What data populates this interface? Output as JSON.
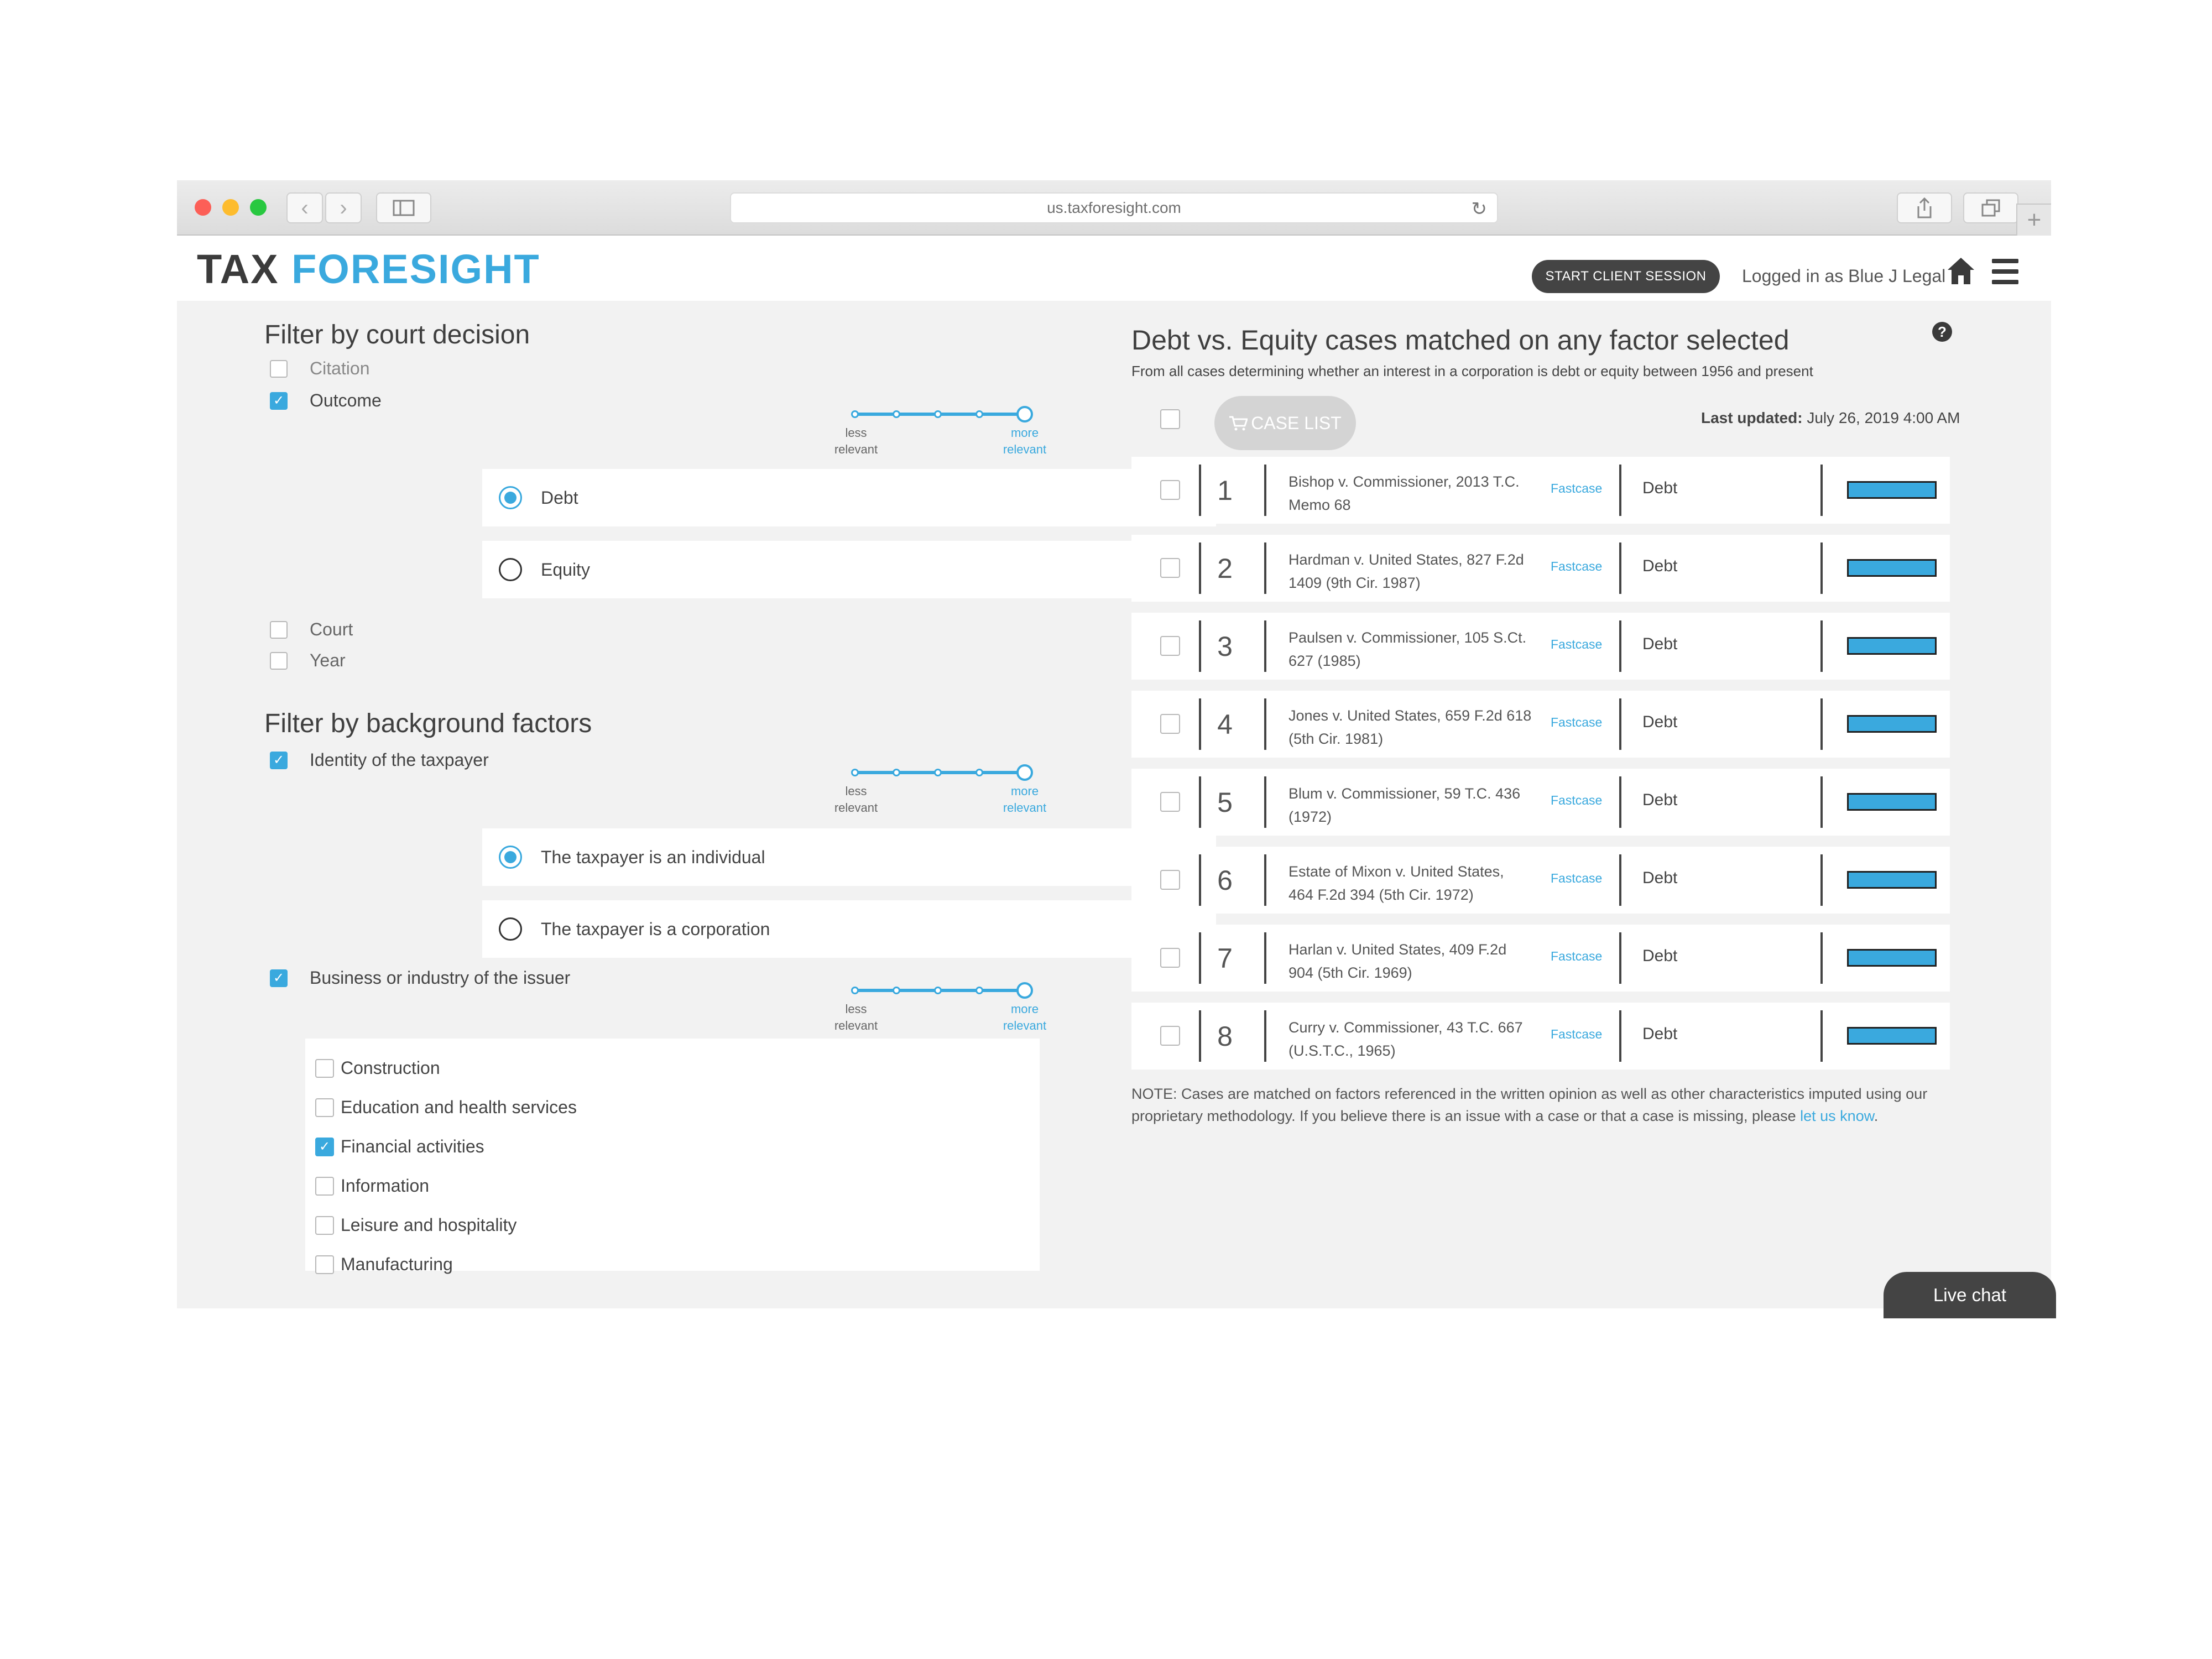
{
  "browser": {
    "url": "us.taxforesight.com",
    "new_tab_glyph": "+"
  },
  "header": {
    "logo_part1": "TAX",
    "logo_part2": "FORESIGHT",
    "start_session_label": "START CLIENT SESSION",
    "logged_in_text": "Logged in as Blue J Legal"
  },
  "colors": {
    "accent": "#3aa9de",
    "dark": "#444444",
    "background": "#f2f2f2"
  },
  "court_filter": {
    "heading": "Filter by court decision",
    "citation_label": "Citation",
    "outcome_label": "Outcome",
    "outcome_checked": true,
    "relevance_less": "less relevant",
    "relevance_more": "more relevant",
    "options": [
      {
        "label": "Debt",
        "selected": true
      },
      {
        "label": "Equity",
        "selected": false
      }
    ],
    "court_label": "Court",
    "year_label": "Year"
  },
  "background_filter": {
    "heading": "Filter by background factors",
    "identity_label": "Identity of the taxpayer",
    "identity_options": [
      {
        "label": "The taxpayer is an individual",
        "selected": true
      },
      {
        "label": "The taxpayer is a corporation",
        "selected": false
      }
    ],
    "business_label": "Business or industry of the issuer",
    "industries": [
      {
        "label": "Construction",
        "checked": false
      },
      {
        "label": "Education and health services",
        "checked": false
      },
      {
        "label": "Financial activities",
        "checked": true
      },
      {
        "label": "Information",
        "checked": false
      },
      {
        "label": "Leisure and hospitality",
        "checked": false
      },
      {
        "label": "Manufacturing",
        "checked": false
      }
    ]
  },
  "results": {
    "title": "Debt vs. Equity cases matched on any factor selected",
    "subtitle": "From all cases determining whether an interest in a corporation is debt or equity between 1956 and present",
    "case_list_label": "CASE LIST",
    "last_updated_label": "Last updated:",
    "last_updated_value": "July 26, 2019 4:00 AM",
    "fastcase_label": "Fastcase",
    "cases": [
      {
        "num": "1",
        "name": "Bishop v. Commissioner, 2013 T.C. Memo 68",
        "outcome": "Debt"
      },
      {
        "num": "2",
        "name": "Hardman v. United States, 827 F.2d 1409 (9th Cir. 1987)",
        "outcome": "Debt"
      },
      {
        "num": "3",
        "name": "Paulsen v. Commissioner, 105 S.Ct. 627 (1985)",
        "outcome": "Debt"
      },
      {
        "num": "4",
        "name": "Jones v. United States, 659 F.2d 618 (5th Cir. 1981)",
        "outcome": "Debt"
      },
      {
        "num": "5",
        "name": "Blum v. Commissioner, 59 T.C. 436 (1972)",
        "outcome": "Debt"
      },
      {
        "num": "6",
        "name": "Estate of Mixon v. United States, 464 F.2d 394 (5th Cir. 1972)",
        "outcome": "Debt"
      },
      {
        "num": "7",
        "name": "Harlan v. United States, 409 F.2d 904 (5th Cir. 1969)",
        "outcome": "Debt"
      },
      {
        "num": "8",
        "name": "Curry v. Commissioner, 43 T.C. 667 (U.S.T.C., 1965)",
        "outcome": "Debt"
      }
    ],
    "note_text": "NOTE: Cases are matched on factors referenced in the written opinion as well as other characteristics imputed using our proprietary methodology. If you believe there is an issue with a case or that a case is missing, please",
    "note_link": "let us know",
    "note_end": "."
  },
  "live_chat_label": "Live chat"
}
